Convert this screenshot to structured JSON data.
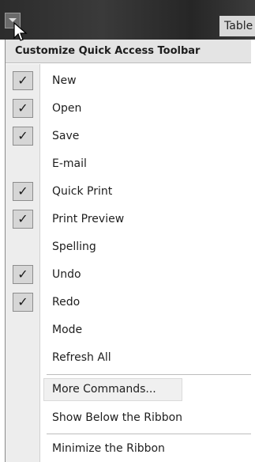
{
  "title_fragment": "Table",
  "menu": {
    "header": "Customize Quick Access Toolbar",
    "items": [
      {
        "label": "New",
        "checked": true
      },
      {
        "label": "Open",
        "checked": true
      },
      {
        "label": "Save",
        "checked": true
      },
      {
        "label": "E-mail",
        "checked": false
      },
      {
        "label": "Quick Print",
        "checked": true
      },
      {
        "label": "Print Preview",
        "checked": true
      },
      {
        "label": "Spelling",
        "checked": false
      },
      {
        "label": "Undo",
        "checked": true
      },
      {
        "label": "Redo",
        "checked": true
      },
      {
        "label": "Mode",
        "checked": false
      },
      {
        "label": "Refresh All",
        "checked": false
      }
    ],
    "more_commands": "More Commands...",
    "show_below": "Show Below the Ribbon",
    "minimize": "Minimize the Ribbon"
  },
  "check_mark": "✓"
}
